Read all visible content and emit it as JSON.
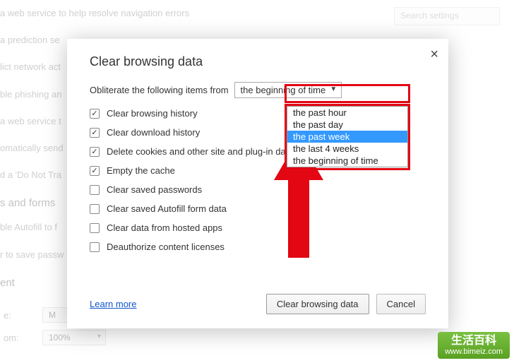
{
  "background": {
    "search_placeholder": "Search settings",
    "rows": [
      "a web service to help resolve navigation errors",
      "a prediction se",
      "lict network act",
      "ble phishing an",
      "a web service t",
      "omatically send",
      "d a 'Do Not Tra"
    ],
    "section_heading": "s and forms",
    "more_rows": [
      "ble Autofill to f",
      "r to save passw"
    ],
    "section_heading2": "ent",
    "bottom": [
      {
        "label": "e:",
        "value": "M"
      },
      {
        "label": "om:",
        "value": "100%"
      }
    ]
  },
  "dialog": {
    "title": "Clear browsing data",
    "close": "×",
    "obliterate_label": "Obliterate the following items from",
    "time_selected": "the beginning of time",
    "dropdown_options": [
      {
        "label": "the past hour",
        "selected": false
      },
      {
        "label": "the past day",
        "selected": false
      },
      {
        "label": "the past week",
        "selected": true
      },
      {
        "label": "the last 4 weeks",
        "selected": false
      },
      {
        "label": "the beginning of time",
        "selected": false
      }
    ],
    "checks": [
      {
        "label": "Clear browsing history",
        "checked": true
      },
      {
        "label": "Clear download history",
        "checked": true
      },
      {
        "label": "Delete cookies and other site and plug-in data",
        "checked": true
      },
      {
        "label": "Empty the cache",
        "checked": true
      },
      {
        "label": "Clear saved passwords",
        "checked": false
      },
      {
        "label": "Clear saved Autofill form data",
        "checked": false
      },
      {
        "label": "Clear data from hosted apps",
        "checked": false
      },
      {
        "label": "Deauthorize content licenses",
        "checked": false
      }
    ],
    "learn_more": "Learn more",
    "primary_btn": "Clear browsing data",
    "cancel_btn": "Cancel"
  },
  "watermark": {
    "text": "生活百科",
    "url": "www.bimeiz.com"
  }
}
